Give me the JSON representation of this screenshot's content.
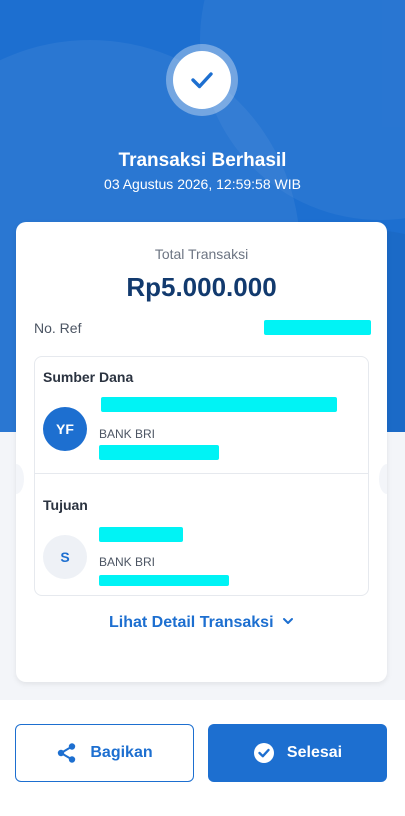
{
  "status": {
    "title": "Transaksi Berhasil",
    "datetime": "03 Agustus 2026, 12:59:58 WIB"
  },
  "transaction": {
    "total_label": "Total Transaksi",
    "total_amount": "Rp5.000.000",
    "ref_label": "No. Ref"
  },
  "source": {
    "section_title": "Sumber Dana",
    "avatar_initials": "YF",
    "bank": "BANK BRI"
  },
  "destination": {
    "section_title": "Tujuan",
    "avatar_initials": "S",
    "bank": "BANK BRI"
  },
  "detail_link": "Lihat Detail Transaksi",
  "actions": {
    "share_label": "Bagikan",
    "done_label": "Selesai"
  },
  "colors": {
    "primary": "#1d6fd0",
    "amount": "#123a6e",
    "redaction": "#00f3f5"
  }
}
